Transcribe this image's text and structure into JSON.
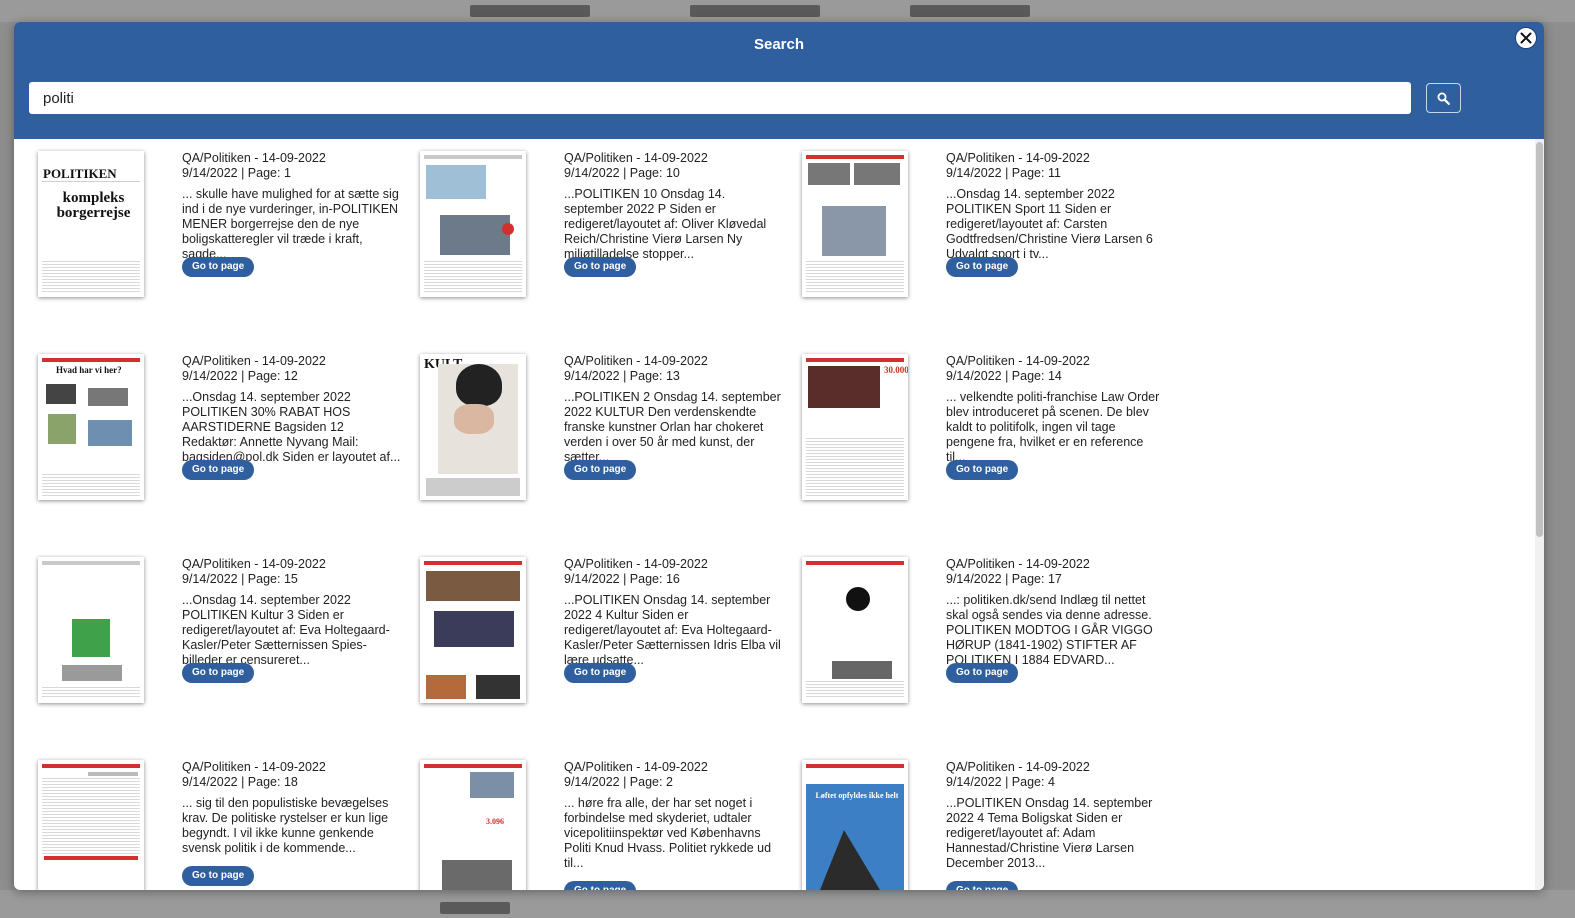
{
  "modal": {
    "title": "Search",
    "close_icon": "close-icon",
    "search": {
      "value": "politi",
      "button_icon": "search-icon"
    }
  },
  "results": [
    {
      "source": "QA/Politiken - 14-09-2022",
      "date_page": "9/14/2022 | Page: 1",
      "snippet": "... skulle have mulighed for at sætte sig ind i de nye vurderinger, in-POLITIKEN MENER borgerrejse den de nye boligskatteregler vil træde i kraft, sagde...",
      "button_label": "Go to page",
      "thumb": {
        "masthead": "POLITIKEN",
        "headline": "kompleks borgerrejse"
      }
    },
    {
      "source": "QA/Politiken - 14-09-2022",
      "date_page": "9/14/2022 | Page: 10",
      "snippet": "...POLITIKEN 10 Onsdag 14. september 2022 P Siden er redigeret/layoutet af: Oliver Kløvedal Reich/Christine Vierø Larsen Ny miljøtilladelse stopper...",
      "button_label": "Go to page",
      "thumb": {}
    },
    {
      "source": "QA/Politiken - 14-09-2022",
      "date_page": "9/14/2022 | Page: 11",
      "snippet": "...Onsdag 14. september 2022 POLITIKEN Sport 11 Siden er redigeret/layoutet af: Carsten Godtfredsen/Christine Vierø Larsen 6 Udvalgt sport i tv...",
      "button_label": "Go to page",
      "thumb": {}
    },
    {
      "source": "QA/Politiken - 14-09-2022",
      "date_page": "9/14/2022 | Page: 12",
      "snippet": "...Onsdag 14. september 2022 POLITIKEN 30% RABAT HOS AARSTIDERNE Bagsiden 12 Redaktør: Annette Nyvang Mail: bagsiden@pol.dk Siden er layoutet af...",
      "button_label": "Go to page",
      "thumb": {
        "headline": "Hvad har vi her?"
      }
    },
    {
      "source": "QA/Politiken - 14-09-2022",
      "date_page": "9/14/2022 | Page: 13",
      "snippet": "...POLITIKEN 2 Onsdag 14. september 2022 KULTUR Den verdenskendte franske kunstner Orlan har chokeret verden i over 50 år med kunst, der sætter...",
      "button_label": "Go to page",
      "thumb": {
        "masthead": "KULT"
      }
    },
    {
      "source": "QA/Politiken - 14-09-2022",
      "date_page": "9/14/2022 | Page: 14",
      "snippet": "... velkendte politi-franchise Law Order blev introduceret på scenen. De blev kaldt to politifolk, ingen vil tage pengene fra, hvilket er en reference til...",
      "button_label": "Go to page",
      "thumb": {}
    },
    {
      "source": "QA/Politiken - 14-09-2022",
      "date_page": "9/14/2022 | Page: 15",
      "snippet": "...Onsdag 14. september 2022 POLITIKEN Kultur 3 Siden er redigeret/layoutet af: Eva Holtegaard-Kasler/Peter Sætternissen Spies-billeder er censureret...",
      "button_label": "Go to page",
      "thumb": {}
    },
    {
      "source": "QA/Politiken - 14-09-2022",
      "date_page": "9/14/2022 | Page: 16",
      "snippet": "...POLITIKEN Onsdag 14. september 2022 4 Kultur Siden er redigeret/layoutet af: Eva Holtegaard-Kasler/Peter Sætternissen Idris Elba vil lære udsatte...",
      "button_label": "Go to page",
      "thumb": {}
    },
    {
      "source": "QA/Politiken - 14-09-2022",
      "date_page": "9/14/2022 | Page: 17",
      "snippet": "...: politiken.dk/send Indlæg til nettet skal også sendes via denne adresse. POLITIKEN MODTOG I GÅR VIGGO HØRUP (1841-1902) STIFTER AF POLITIKEN I 1884 EDVARD...",
      "button_label": "Go to page",
      "thumb": {}
    },
    {
      "source": "QA/Politiken - 14-09-2022",
      "date_page": "9/14/2022 | Page: 18",
      "snippet": "... sig til den populistiske bevægelses krav. De politiske rystelser er kun lige begyndt. I vil ikke kunne genkende svensk politik i de kommende...",
      "button_label": "Go to page",
      "thumb": {}
    },
    {
      "source": "QA/Politiken - 14-09-2022",
      "date_page": "9/14/2022 | Page: 2",
      "snippet": "... høre fra alle, der har set noget i forbindelse med skyderiet, udtaler vicepolitiinspektør ved Københavns Politi Knud Hvass. Politiet rykkede ud til...",
      "button_label": "Go to page",
      "thumb": {}
    },
    {
      "source": "QA/Politiken - 14-09-2022",
      "date_page": "9/14/2022 | Page: 4",
      "snippet": "...POLITIKEN Onsdag 14. september 2022 4 Tema Boligskat Siden er redigeret/layoutet af: Adam Hannestad/Christine Vierø Larsen December 2013...",
      "button_label": "Go to page",
      "thumb": {
        "headline": "Løftet opfyldes ikke helt"
      }
    }
  ]
}
